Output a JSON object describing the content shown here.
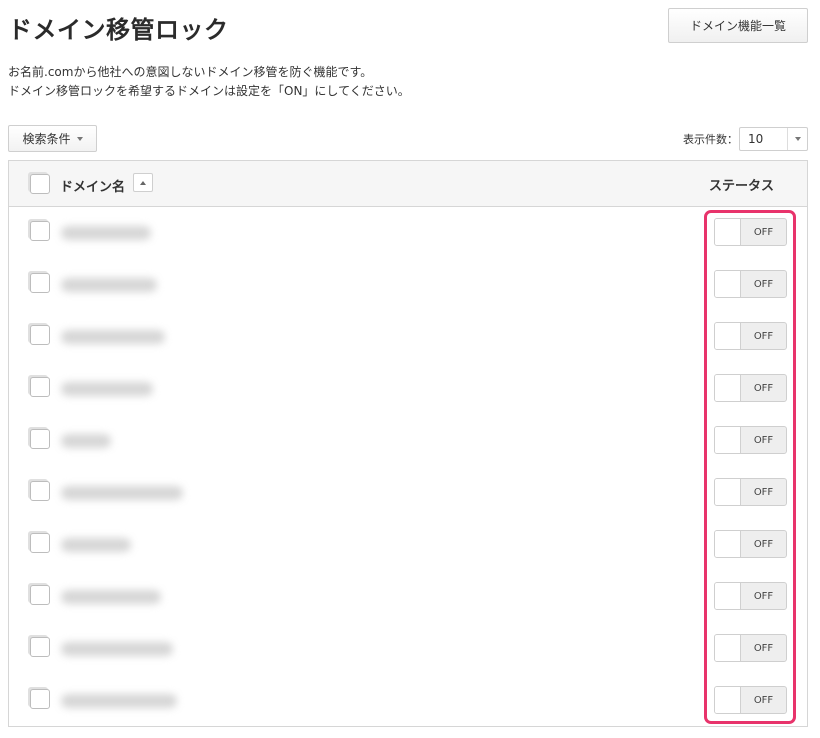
{
  "page": {
    "title": "ドメイン移管ロック",
    "list_button": "ドメイン機能一覧",
    "description": [
      "お名前.comから他社への意図しないドメイン移管を防ぐ機能です。",
      "ドメイン移管ロックを希望するドメインは設定を「ON」にしてください。"
    ]
  },
  "toolbar": {
    "search_label": "検索条件",
    "count_label": "表示件数：",
    "count_value": "10"
  },
  "table": {
    "col_domain": "ドメイン名",
    "col_status": "ステータス",
    "rows": [
      {
        "status": "OFF"
      },
      {
        "status": "OFF"
      },
      {
        "status": "OFF"
      },
      {
        "status": "OFF"
      },
      {
        "status": "OFF"
      },
      {
        "status": "OFF"
      },
      {
        "status": "OFF"
      },
      {
        "status": "OFF"
      },
      {
        "status": "OFF"
      },
      {
        "status": "OFF"
      }
    ]
  },
  "colors": {
    "highlight": "#e8336b",
    "toggle_off_bg": "#eeeeee"
  }
}
